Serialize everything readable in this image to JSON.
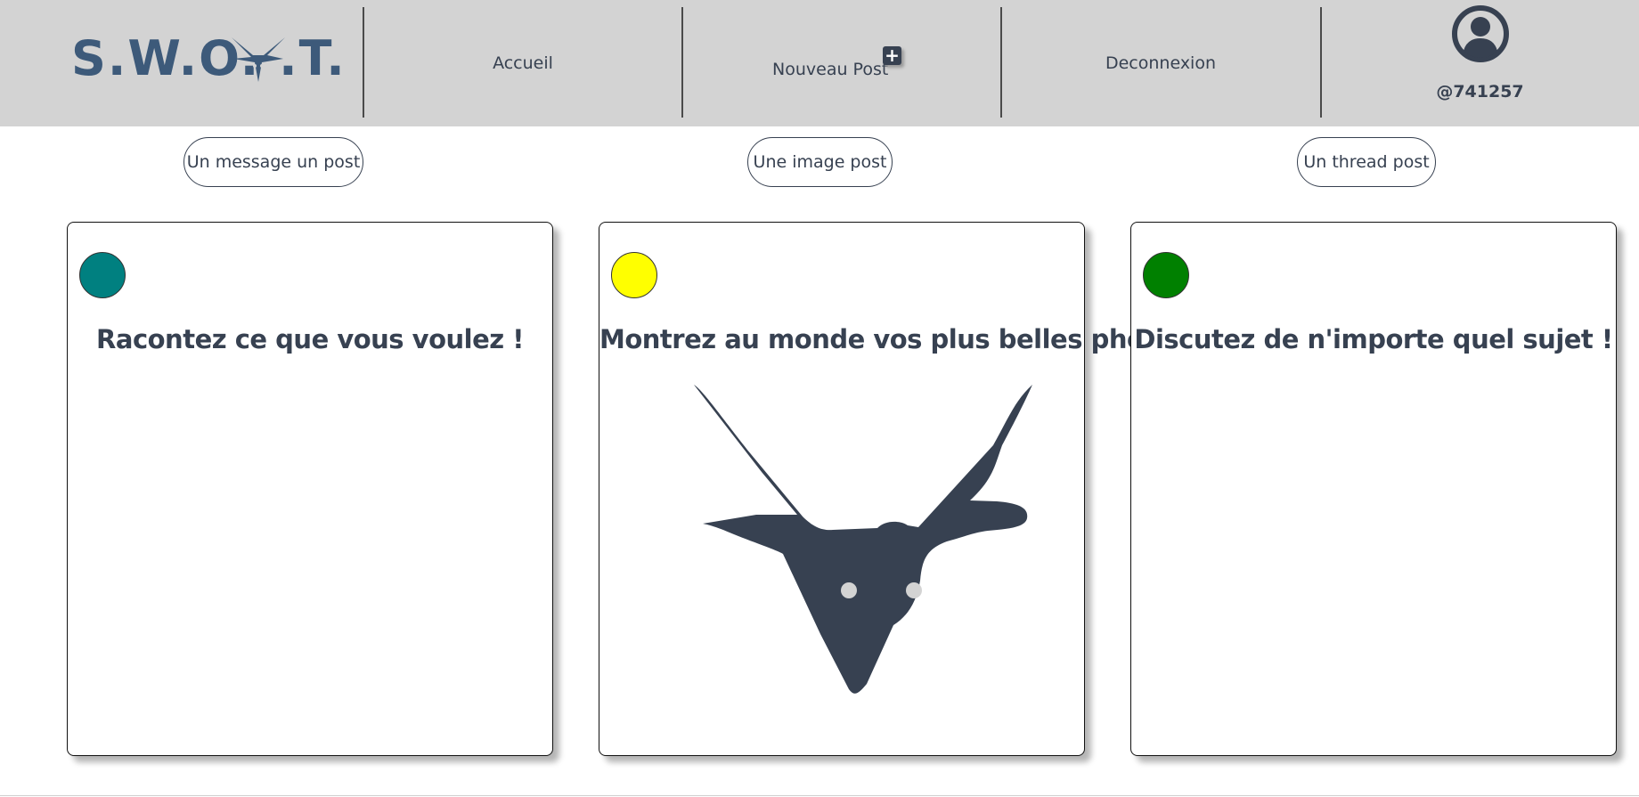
{
  "header": {
    "logo_text": "S.W.O.  .T.",
    "nav": {
      "home": "Accueil",
      "new_post": "Nouveau Post",
      "new_post_icon": "plus-square-icon",
      "logout": "Deconnexion"
    },
    "profile": {
      "avatar_icon": "user-circle-icon",
      "handle": "@741257"
    }
  },
  "post_types": [
    {
      "label": "Un message un post"
    },
    {
      "label": "Une image post"
    },
    {
      "label": "Un thread post"
    }
  ],
  "cards": [
    {
      "title": "Racontez ce que vous voulez !",
      "color": "#008080"
    },
    {
      "title": "Montrez au monde vos plus belles photos",
      "color": "#ffff00",
      "image": "goat-head-icon"
    },
    {
      "title": "Discutez de n'importe quel sujet !",
      "color": "#008000"
    }
  ],
  "colors": {
    "header_bg": "#d3d3d3",
    "text": "#374151",
    "logo": "#3d5a7a"
  }
}
